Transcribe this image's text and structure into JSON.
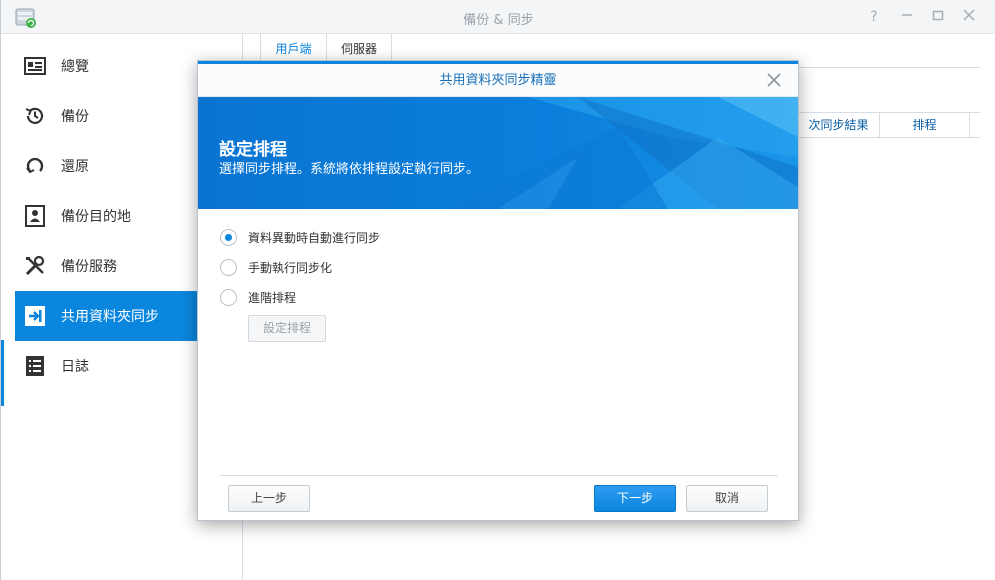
{
  "window": {
    "title": "備份 & 同步"
  },
  "sidebar": {
    "items": [
      {
        "label": "總覽",
        "icon": "overview-icon"
      },
      {
        "label": "備份",
        "icon": "backup-clock-icon"
      },
      {
        "label": "還原",
        "icon": "restore-icon"
      },
      {
        "label": "備份目的地",
        "icon": "destination-icon"
      },
      {
        "label": "備份服務",
        "icon": "tools-icon"
      },
      {
        "label": "共用資料夾同步",
        "icon": "folder-sync-icon",
        "active": true
      },
      {
        "label": "日誌",
        "icon": "log-icon"
      }
    ]
  },
  "main": {
    "tabs": [
      {
        "label": "用戶端",
        "selected": true
      },
      {
        "label": "伺服器"
      }
    ],
    "columns": [
      "次同步結果",
      "排程"
    ]
  },
  "dialog": {
    "title": "共用資料夾同步精靈",
    "banner_title": "設定排程",
    "banner_subtitle": "選擇同步排程。系統將依排程設定執行同步。",
    "options": [
      {
        "label": "資料異動時自動進行同步",
        "selected": true
      },
      {
        "label": "手動執行同步化",
        "selected": false
      },
      {
        "label": "進階排程",
        "selected": false
      }
    ],
    "schedule_button": "設定排程",
    "back_button": "上一步",
    "next_button": "下一步",
    "cancel_button": "取消"
  },
  "colors": {
    "accent": "#0b86de",
    "banner_dark": "#0a74d1",
    "banner_light": "#2aa8f0"
  }
}
